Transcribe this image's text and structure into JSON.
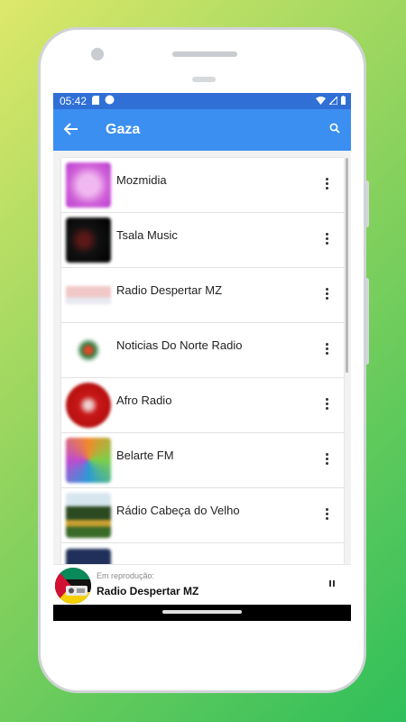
{
  "status": {
    "time": "05:42"
  },
  "appbar": {
    "title": "Gaza"
  },
  "stations": [
    {
      "name": "Mozmidia",
      "thumb": "mozmidia-logo"
    },
    {
      "name": "Tsala Music",
      "thumb": "tsala-music-logo"
    },
    {
      "name": "Radio Despertar MZ",
      "thumb": "radio-despertar-logo"
    },
    {
      "name": "Noticias Do Norte Radio",
      "thumb": "noticias-do-norte-logo"
    },
    {
      "name": "Afro Radio",
      "thumb": "afro-radio-logo"
    },
    {
      "name": "Belarte FM",
      "thumb": "belarte-fm-logo"
    },
    {
      "name": "Rádio Cabeça do Velho",
      "thumb": "radio-cabeca-logo"
    }
  ],
  "player": {
    "label": "Em reprodução:",
    "station": "Radio Despertar MZ"
  },
  "colors": {
    "statusbar": "#2f6fd6",
    "appbar": "#3b8ff0"
  }
}
